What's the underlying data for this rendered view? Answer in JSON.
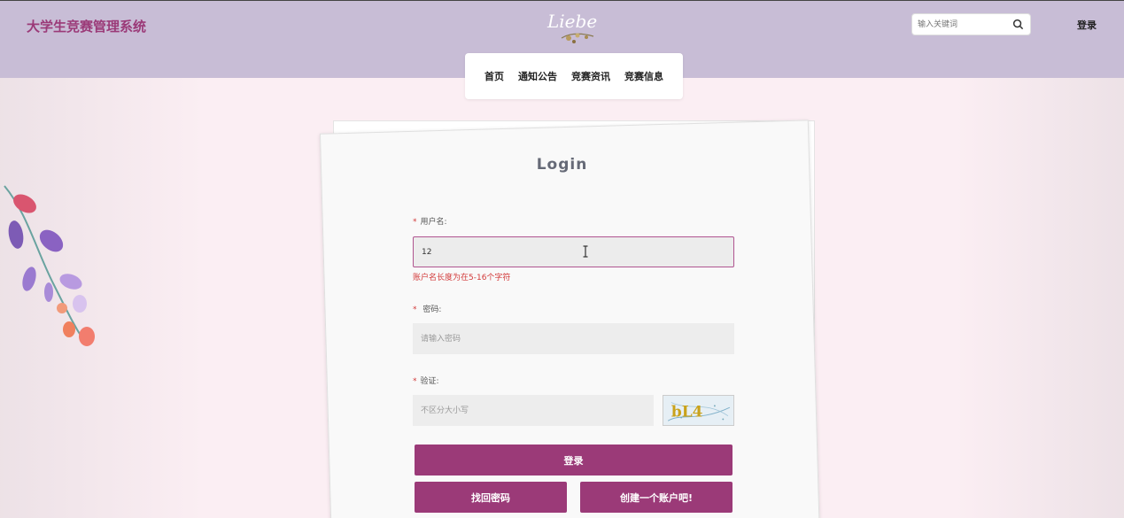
{
  "header": {
    "site_title": "大学生竞赛管理系统",
    "logo_text": "Liebe",
    "search_placeholder": "输入关键词",
    "login_link": "登录"
  },
  "nav": {
    "items": [
      {
        "label": "首页"
      },
      {
        "label": "通知公告"
      },
      {
        "label": "竞赛资讯"
      },
      {
        "label": "竞赛信息"
      }
    ]
  },
  "form": {
    "title": "Login",
    "username": {
      "required_mark": "*",
      "label": "用户名:",
      "value": "12",
      "error": "账户名长度为在5-16个字符"
    },
    "password": {
      "required_mark": "*",
      "label": "密码:",
      "placeholder": "请输入密码"
    },
    "captcha": {
      "required_mark": "*",
      "label": "验证:",
      "placeholder": "不区分大小写",
      "image_text": "bL4"
    },
    "buttons": {
      "login": "登录",
      "forgot": "找回密码",
      "register": "创建一个账户吧!"
    }
  },
  "colors": {
    "header_bg": "#c8bdd6",
    "accent": "#9b3a78",
    "error": "#d23a3a",
    "page_bg": "#fbeef3"
  }
}
